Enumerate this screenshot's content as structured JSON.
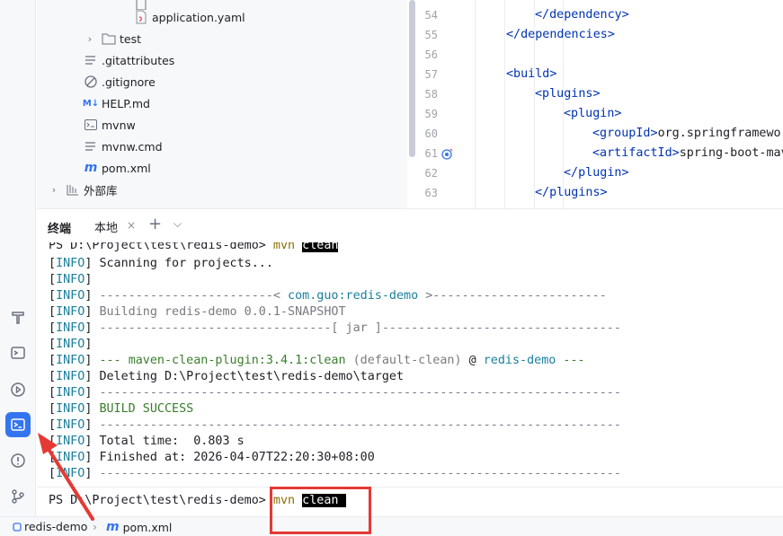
{
  "tree": {
    "items": [
      {
        "label": "application.yaml",
        "icon": "yaml-file-icon"
      },
      {
        "label": "test",
        "icon": "folder-icon"
      },
      {
        "label": ".gitattributes",
        "icon": "text-file-icon"
      },
      {
        "label": ".gitignore",
        "icon": "ignore-file-icon"
      },
      {
        "label": "HELP.md",
        "icon": "markdown-file-icon"
      },
      {
        "label": "mvnw",
        "icon": "shell-script-icon"
      },
      {
        "label": "mvnw.cmd",
        "icon": "text-file-icon"
      },
      {
        "label": "pom.xml",
        "icon": "maven-file-icon"
      },
      {
        "label": "外部库",
        "icon": "library-icon"
      }
    ]
  },
  "editor": {
    "lines": [
      {
        "num": "54",
        "text": "</dependency>"
      },
      {
        "num": "55",
        "text": "</dependencies>"
      },
      {
        "num": "56",
        "text": ""
      },
      {
        "num": "57",
        "text": "<build>"
      },
      {
        "num": "58",
        "text": "<plugins>"
      },
      {
        "num": "59",
        "text": "<plugin>"
      },
      {
        "num": "60",
        "text_tag": "<groupId>",
        "text_val": "org.springframewor"
      },
      {
        "num": "61",
        "text_tag": "<artifactId>",
        "text_val": "spring-boot-mav"
      },
      {
        "num": "62",
        "text": "</plugin>"
      },
      {
        "num": "63",
        "text": "</plugins>"
      }
    ],
    "top_fragment": "</dependency>"
  },
  "terminal": {
    "title": "终端",
    "tab_label": "本地",
    "tab_close": "×",
    "tab_add": "+",
    "tab_menu": "⌵",
    "prompt": "PS D:\\Project\\test\\redis-demo>",
    "command_word": "mvn",
    "command_arg": "clean",
    "level": "INFO",
    "lines": {
      "l1": "Scanning for projects...",
      "l3a": "------------------------< ",
      "l3b": "com.guo:redis-demo",
      "l3c": " >------------------------",
      "l4": "Building redis-demo 0.0.1-SNAPSHOT",
      "l5": "--------------------------------[ jar ]---------------------------------",
      "l7a": "--- ",
      "l7b": "maven-clean-plugin:3.4.1:clean",
      "l7c": " (default-clean)",
      "l7d": " @ ",
      "l7e": "redis-demo",
      "l7f": " ---",
      "l8": "Deleting D:\\Project\\test\\redis-demo\\target",
      "l9": "------------------------------------------------------------------------",
      "l10": "BUILD SUCCESS",
      "l11": "------------------------------------------------------------------------",
      "l12": "Total time:  0.803 s",
      "l13": "Finished at: 2026-04-07T22:20:30+08:00",
      "l14": "------------------------------------------------------------------------"
    }
  },
  "status_bar": {
    "project": "redis-demo",
    "separator": "›",
    "file": "pom.xml"
  },
  "colors": {
    "accent": "#3574f0",
    "annotation": "#e53935",
    "xml_tag": "#0033b3"
  }
}
